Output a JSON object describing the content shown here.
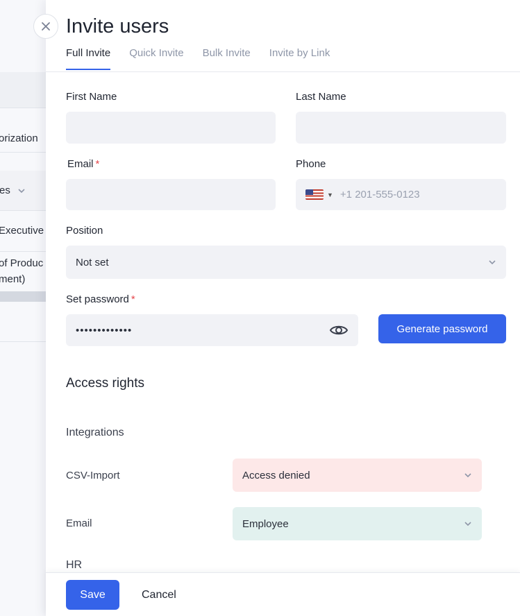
{
  "background": {
    "rows": [
      "orization",
      "es",
      "Executive",
      "of Produc",
      "ment)"
    ]
  },
  "panel": {
    "title": "Invite users",
    "tabs": [
      {
        "label": "Full Invite",
        "active": true
      },
      {
        "label": "Quick Invite",
        "active": false
      },
      {
        "label": "Bulk Invite",
        "active": false
      },
      {
        "label": "Invite by Link",
        "active": false
      }
    ]
  },
  "form": {
    "first_name": {
      "label": "First Name",
      "value": ""
    },
    "last_name": {
      "label": "Last Name",
      "value": ""
    },
    "email": {
      "label": "Email",
      "required_mark": "*",
      "value": ""
    },
    "phone": {
      "label": "Phone",
      "country_flag": "us-flag-icon",
      "placeholder": "+1 201-555-0123"
    },
    "position": {
      "label": "Position",
      "value": "Not set"
    },
    "password": {
      "label": "Set password",
      "required_mark": "*",
      "masked_value": "•••••••••••••"
    },
    "generate_password_label": "Generate password"
  },
  "access_rights": {
    "title": "Access rights",
    "groups": [
      {
        "name": "Integrations",
        "items": [
          {
            "label": "CSV-Import",
            "value": "Access denied",
            "color": "#fde8e8"
          },
          {
            "label": "Email",
            "value": "Employee",
            "color": "#e2f1ef"
          }
        ]
      },
      {
        "name": "HR",
        "items": []
      }
    ]
  },
  "footer": {
    "save_label": "Save",
    "cancel_label": "Cancel"
  },
  "colors": {
    "accent": "#3563e9",
    "required": "#e5484d"
  }
}
